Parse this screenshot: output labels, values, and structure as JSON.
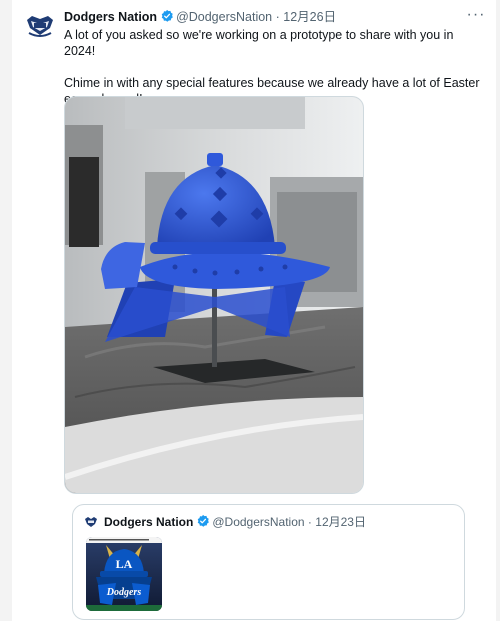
{
  "tweet": {
    "display_name": "Dodgers Nation",
    "handle": "@DodgersNation",
    "separator": "·",
    "date": "12月26日",
    "more_label": "···",
    "text_line1": "A lot of you asked so we're working on a prototype to share with you in 2024!",
    "text_line2": "Chime in with any special features because we already have a lot of Easter eggs planned!",
    "media_icon": "blue-samurai-helmet-prototype-photo"
  },
  "quoted_tweet": {
    "display_name": "Dodgers Nation",
    "handle": "@DodgersNation",
    "separator": "·",
    "date": "12月23日",
    "thumb_icon": "dodgers-samurai-helmet-graphic",
    "thumb_wordmark": "Dodgers",
    "thumb_logo": "LA"
  },
  "colors": {
    "verified_blue": "#1d9bf0",
    "helmet_blue": "#2c56d6",
    "dodgers_blue": "#005a9c"
  }
}
